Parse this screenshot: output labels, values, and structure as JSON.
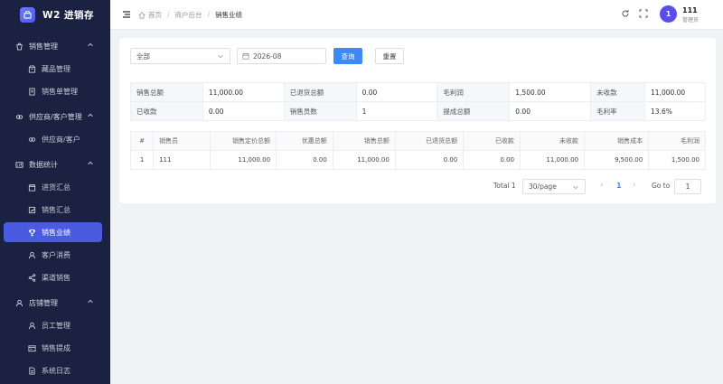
{
  "app": {
    "title": "W2 进销存"
  },
  "sidebar": {
    "groups": [
      {
        "label": "销售管理",
        "icon": "shopping-bag-icon",
        "items": [
          {
            "label": "藏品管理",
            "icon": "box-icon"
          },
          {
            "label": "销售单管理",
            "icon": "receipt-icon"
          }
        ]
      },
      {
        "label": "供应商/客户管理",
        "icon": "link-icon",
        "items": [
          {
            "label": "供应商/客户",
            "icon": "link-icon"
          }
        ]
      },
      {
        "label": "数据统计",
        "icon": "chart-icon",
        "items": [
          {
            "label": "进货汇总",
            "icon": "calendar-icon"
          },
          {
            "label": "销售汇总",
            "icon": "bar-chart-icon"
          },
          {
            "label": "销售业绩",
            "icon": "trophy-icon",
            "active": true
          },
          {
            "label": "客户消费",
            "icon": "user-icon"
          },
          {
            "label": "渠道销售",
            "icon": "share-icon"
          }
        ]
      },
      {
        "label": "店铺管理",
        "icon": "user-icon",
        "items": [
          {
            "label": "员工管理",
            "icon": "user-icon"
          },
          {
            "label": "销售提成",
            "icon": "wallet-icon"
          },
          {
            "label": "系统日志",
            "icon": "document-icon"
          }
        ]
      }
    ]
  },
  "header": {
    "breadcrumbs": [
      "首页",
      "商户后台",
      "销售业绩"
    ],
    "user": {
      "avatar": "1",
      "name": "111",
      "role": "管理员"
    }
  },
  "filters": {
    "select_value": "全部",
    "date_value": "2026-08",
    "query_label": "查询",
    "reset_label": "重置"
  },
  "summary": [
    [
      {
        "label": "销售总额",
        "value": "11,000.00"
      },
      {
        "label": "已退货总额",
        "value": "0.00"
      },
      {
        "label": "毛利润",
        "value": "1,500.00"
      },
      {
        "label": "未收款",
        "value": "11,000.00"
      }
    ],
    [
      {
        "label": "已收款",
        "value": "0.00"
      },
      {
        "label": "销售员数",
        "value": "1"
      },
      {
        "label": "提成总额",
        "value": "0.00"
      },
      {
        "label": "毛利率",
        "value": "13.6%"
      }
    ]
  ],
  "table": {
    "columns": [
      "#",
      "销售员",
      "销售定价总额",
      "优惠总额",
      "销售总额",
      "已退货总额",
      "已收款",
      "未收款",
      "销售成本",
      "毛利润"
    ],
    "rows": [
      [
        "1",
        "111",
        "11,000.00",
        "0.00",
        "11,000.00",
        "0.00",
        "0.00",
        "11,000.00",
        "9,500.00",
        "1,500.00"
      ]
    ]
  },
  "pagination": {
    "total": "Total 1",
    "page_size": "30/page",
    "current": "1",
    "goto_label": "Go to",
    "goto_value": "1"
  },
  "colors": {
    "sidebar_bg": "#1b2140",
    "active": "#4a5be0",
    "primary": "#3d8af7"
  }
}
